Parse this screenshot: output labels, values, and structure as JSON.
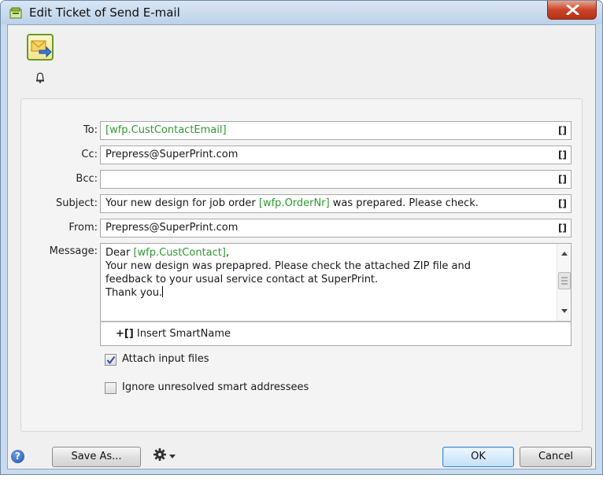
{
  "window": {
    "title": "Edit Ticket of Send E-mail",
    "close_label": "X"
  },
  "fields": {
    "to": {
      "label": "To:",
      "smartname": "[wfp.CustContactEmail]"
    },
    "cc": {
      "label": "Cc:",
      "value": "Prepress@SuperPrint.com"
    },
    "bcc": {
      "label": "Bcc:",
      "value": ""
    },
    "subject": {
      "label": "Subject:",
      "pre": "Your new design for job order ",
      "smartname": "[wfp.OrderNr]",
      "post": " was prepared. Please check."
    },
    "from": {
      "label": "From:",
      "value": "Prepress@SuperPrint.com"
    },
    "bracket": "[]"
  },
  "message": {
    "label": "Message:",
    "greeting": "Dear ",
    "greeting_smartname": "[wfp.CustContact]",
    "greeting_end": ",",
    "line2": "Your new design was prepapred. Please check the attached ZIP file and",
    "line3": "feedback to your usual service contact at SuperPrint.",
    "line4": "Thank you."
  },
  "insert_smartname": {
    "prefix": "+[]",
    "label": " Insert SmartName"
  },
  "options": {
    "attach": {
      "label": "Attach input files",
      "checked": true
    },
    "ignore": {
      "label": "Ignore unresolved smart addressees",
      "checked": false
    }
  },
  "footer": {
    "help": "?",
    "save_as": "Save As...",
    "ok": "OK",
    "cancel": "Cancel"
  },
  "icons": {
    "app": "email-send-icon",
    "bell": "bell-icon",
    "gear": "gear-icon"
  },
  "colors": {
    "smartname": "#2e9a2e",
    "titlebar": "#c9dbee",
    "close": "#c8442a"
  }
}
